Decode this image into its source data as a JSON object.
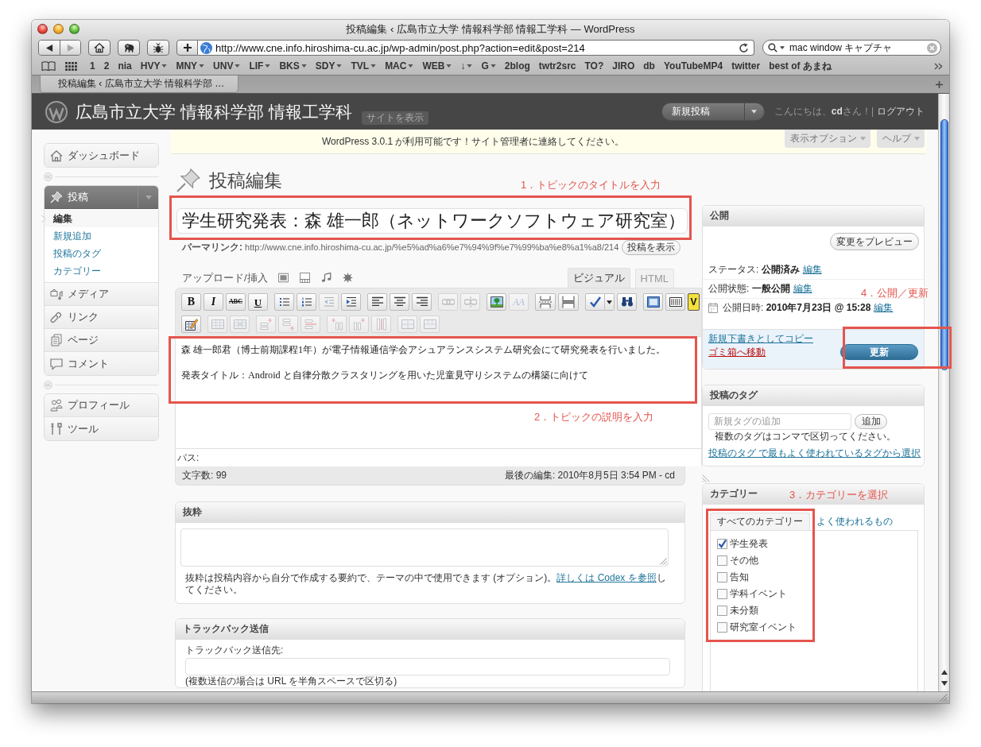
{
  "window": {
    "title": "投稿編集 ‹ 広島市立大学 情報科学部 情報工学科 — WordPress"
  },
  "browser": {
    "nav_buttons": [
      {
        "kind": "back",
        "disabled": false
      },
      {
        "kind": "forward",
        "disabled": true
      }
    ],
    "address": "http://www.cne.info.hiroshima-cu.ac.jp/wp-admin/post.php?action=edit&post=214",
    "search": "mac window キャプチャ",
    "bookmarks": [
      {
        "label": "1",
        "menu": false
      },
      {
        "label": "2",
        "menu": false
      },
      {
        "label": "nia",
        "menu": false
      },
      {
        "label": "HVY",
        "menu": true
      },
      {
        "label": "MNY",
        "menu": true
      },
      {
        "label": "UNV",
        "menu": true
      },
      {
        "label": "LIF",
        "menu": true
      },
      {
        "label": "BKS",
        "menu": true
      },
      {
        "label": "SDY",
        "menu": true
      },
      {
        "label": "TVL",
        "menu": true
      },
      {
        "label": "MAC",
        "menu": true
      },
      {
        "label": "WEB",
        "menu": true
      },
      {
        "label": "↓",
        "menu": true
      },
      {
        "label": "G",
        "menu": true
      },
      {
        "label": "2blog",
        "menu": false
      },
      {
        "label": "twtr2src",
        "menu": false
      },
      {
        "label": "TO?",
        "menu": false
      },
      {
        "label": "JIRO",
        "menu": false
      },
      {
        "label": "db",
        "menu": false
      },
      {
        "label": "YouTubeMP4",
        "menu": false
      },
      {
        "label": "twitter",
        "menu": false
      },
      {
        "label": "best of あまね",
        "menu": false
      }
    ],
    "tabs": [
      {
        "label": "投稿編集 ‹ 広島市立大学 情報科学部 …",
        "selected": true
      }
    ]
  },
  "header": {
    "site_title": "広島市立大学 情報科学部 情報工学科",
    "view_site": "サイトを表示",
    "new_post": "新規投稿",
    "greeting": "こんにちは、**cd**さん！|",
    "logout": "ログアウト"
  },
  "menu": [
    {
      "items": [
        {
          "kind": "dashboard",
          "label": "ダッシュボード",
          "expanded": false
        }
      ]
    },
    {
      "items": [
        {
          "kind": "posts",
          "label": "投稿",
          "expanded": true,
          "children": [
            {
              "label": "編集",
              "selected": true
            },
            {
              "label": "新規追加",
              "selected": false
            },
            {
              "label": "投稿のタグ",
              "selected": false
            },
            {
              "label": "カテゴリー",
              "selected": false
            }
          ]
        },
        {
          "kind": "media",
          "label": "メディア",
          "expanded": false
        },
        {
          "kind": "links",
          "label": "リンク",
          "expanded": false
        },
        {
          "kind": "pages",
          "label": "ページ",
          "expanded": false
        },
        {
          "kind": "comments",
          "label": "コメント",
          "expanded": false
        }
      ]
    },
    {
      "items": [
        {
          "kind": "profile",
          "label": "プロフィール",
          "expanded": false
        },
        {
          "kind": "tools",
          "label": "ツール",
          "expanded": false
        }
      ]
    }
  ],
  "notice": "WordPress 3.0.1 が利用可能です！サイト管理者に連絡してください。",
  "screen_options": [
    {
      "label": "表示オプション"
    },
    {
      "label": "ヘルプ"
    }
  ],
  "heading": "投稿編集",
  "editor": {
    "title": "学生研究発表：森 雄一郎（ネットワークソフトウェア研究室）",
    "permalink": "**パーマリンク:** http://www.cne.info.hiroshima-cu.ac.jp/%e5%ad%a6%e7%94%9f%e7%99%ba%e8%a1%a8/214",
    "view_post": "投稿を表示",
    "upload_label": "アップロード/挿入",
    "media_buttons": [
      {
        "kind": "image"
      },
      {
        "kind": "video"
      },
      {
        "kind": "audio"
      },
      {
        "kind": "media"
      }
    ],
    "mode_tabs": [
      {
        "label": "ビジュアル",
        "selected": true
      },
      {
        "label": "HTML",
        "selected": false
      }
    ],
    "toolbar": [
      [
        [
          {
            "kind": "bold",
            "label": "B",
            "disabled": false
          },
          {
            "kind": "italic",
            "label": "I",
            "disabled": false
          },
          {
            "kind": "strike",
            "label": "ABC",
            "disabled": false
          },
          {
            "kind": "underline",
            "label": "U",
            "disabled": false
          }
        ],
        [
          {
            "kind": "bullist",
            "disabled": false
          },
          {
            "kind": "numlist",
            "disabled": false
          },
          {
            "kind": "outdent",
            "disabled": true
          },
          {
            "kind": "indent",
            "disabled": false
          }
        ],
        [
          {
            "kind": "alignleft",
            "disabled": false
          },
          {
            "kind": "aligncenter",
            "disabled": false
          },
          {
            "kind": "alignright",
            "disabled": false
          }
        ],
        [
          {
            "kind": "link",
            "disabled": true
          },
          {
            "kind": "unlink",
            "disabled": true
          }
        ],
        [
          {
            "kind": "image",
            "disabled": false
          },
          {
            "kind": "textcolor",
            "label": "AA",
            "disabled": true
          }
        ],
        [
          {
            "kind": "pagebreak",
            "disabled": false
          },
          {
            "kind": "more",
            "disabled": false
          }
        ],
        [
          {
            "kind": "spellcheck",
            "disabled": false
          },
          {
            "kind": "menu",
            "disabled": false
          },
          {
            "kind": "find",
            "disabled": false
          }
        ],
        [
          {
            "kind": "fullscreen",
            "disabled": false
          },
          {
            "kind": "kitchensink",
            "disabled": false
          },
          {
            "kind": "vbadge",
            "label": "V",
            "disabled": false
          }
        ]
      ],
      [
        [
          {
            "kind": "edit",
            "disabled": false
          }
        ],
        [
          {
            "kind": "rowprops",
            "disabled": true
          },
          {
            "kind": "cellprops",
            "disabled": true
          }
        ],
        [
          {
            "kind": "rowbefore",
            "disabled": true
          },
          {
            "kind": "rowafter",
            "disabled": true
          },
          {
            "kind": "rowdelete",
            "disabled": true
          }
        ],
        [
          {
            "kind": "colbefore",
            "disabled": true
          },
          {
            "kind": "colafter",
            "disabled": true
          },
          {
            "kind": "coldelete",
            "disabled": true
          }
        ],
        [
          {
            "kind": "split",
            "disabled": true
          },
          {
            "kind": "merge",
            "disabled": true
          }
        ]
      ]
    ],
    "paragraphs": [
      "森 雄一郎君（博士前期課程1年）が電子情報通信学会アシュアランスシステム研究会にて研究発表を行いました。",
      "発表タイトル：Android と自律分散クラスタリングを用いた児童見守りシステムの構築に向けて"
    ],
    "path_label": "パス:",
    "word_count": "文字数: 99",
    "last_edit": "最後の編集: 2010年8月5日 3:54 PM - cd"
  },
  "excerpt": {
    "title": "抜粋",
    "help": "抜粋は投稿内容から自分で作成する要約で、テーマの中で使用できます (オプション)。",
    "help_link": "詳しくは Codex を参照",
    "help_end": "してください。"
  },
  "trackback": {
    "title": "トラックバック送信",
    "label": "トラックバック送信先:",
    "note": "(複数送信の場合は URL を半角スペースで区切る)"
  },
  "publish": {
    "title": "公開",
    "preview": "変更をプレビュー",
    "rows": [
      {
        "kind": "status",
        "text": "ステータス: **公開済み**",
        "action": "編集"
      },
      {
        "kind": "visibility",
        "text": "公開状態: **一般公開**",
        "action": "編集"
      },
      {
        "kind": "date",
        "text": "公開日時: **2010年7月23日 @ 15:28**",
        "action": "編集"
      }
    ],
    "copy_draft": "新規下書きとしてコピー",
    "trash": "ゴミ箱へ移動",
    "update": "更新"
  },
  "tags": {
    "title": "投稿のタグ",
    "placeholder": "新規タグの追加",
    "add": "追加",
    "hint": "複数のタグはコンマで区切ってください。",
    "popular_link": "投稿のタグ で最もよく使われているタグから選択"
  },
  "categories": {
    "title": "カテゴリー",
    "tabs": [
      {
        "label": "すべてのカテゴリー",
        "selected": true
      },
      {
        "label": "よく使われるもの",
        "selected": false
      }
    ],
    "items": [
      {
        "label": "学生発表",
        "checked": true
      },
      {
        "label": "その他",
        "checked": false
      },
      {
        "label": "告知",
        "checked": false
      },
      {
        "label": "学科イベント",
        "checked": false
      },
      {
        "label": "未分類",
        "checked": false
      },
      {
        "label": "研究室イベント",
        "checked": false
      }
    ]
  },
  "annotations": [
    {
      "label": "1．トピックのタイトルを入力"
    },
    {
      "label": "2．トピックの説明を入力"
    },
    {
      "label": "3．カテゴリーを選択"
    },
    {
      "label": "4．公開／更新"
    }
  ]
}
